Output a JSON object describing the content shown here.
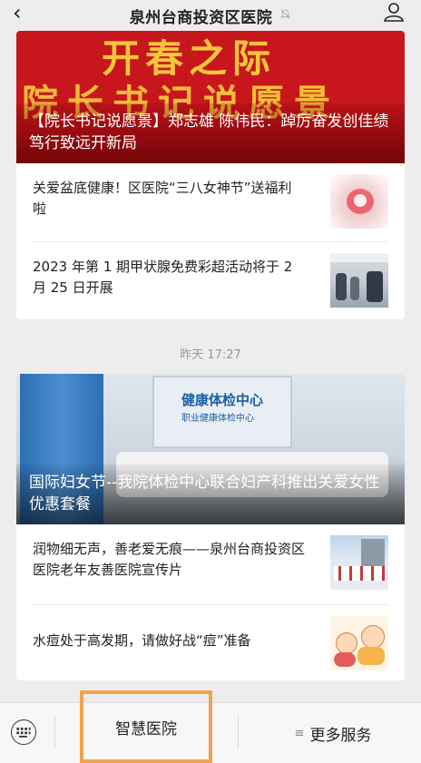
{
  "header": {
    "back_label": "‹",
    "title": "泉州台商投资区医院",
    "mute_icon": "bell-slash-icon",
    "user_icon": "user-icon"
  },
  "card1": {
    "hero": {
      "banner_line1": "开春之际",
      "banner_line2": "院长书记说愿景",
      "caption": "【院长书记说愿景】郑志雄 陈伟民：踔厉奋发创佳绩 笃行致远开新局"
    },
    "items": [
      {
        "title": "关爱盆底健康！区医院“三八女神节”送福利啦"
      },
      {
        "title": "2023 年第 1 期甲状腺免费彩超活动将于 2 月 25 日开展"
      }
    ]
  },
  "timestamp": "昨天 17:27",
  "card2": {
    "hero": {
      "sign_line1": "健康体检中心",
      "sign_line2": "职业健康体检中心",
      "caption": "国际妇女节--我院体检中心联合妇产科推出关爱女性优惠套餐"
    },
    "items": [
      {
        "title": "润物细无声，善老爱无痕——泉州台商投资区医院老年友善医院宣传片"
      },
      {
        "title": "水痘处于高发期，请做好战“痘”准备"
      }
    ]
  },
  "bottom_menu": {
    "keyboard_icon": "keyboard-icon",
    "menu1_label": "智慧医院",
    "menu2_icon": "≡",
    "menu2_label": "更多服务"
  },
  "colors": {
    "highlight": "#f2a24c",
    "banner_red": "#c8161d",
    "banner_gold": "#f5c63a"
  }
}
